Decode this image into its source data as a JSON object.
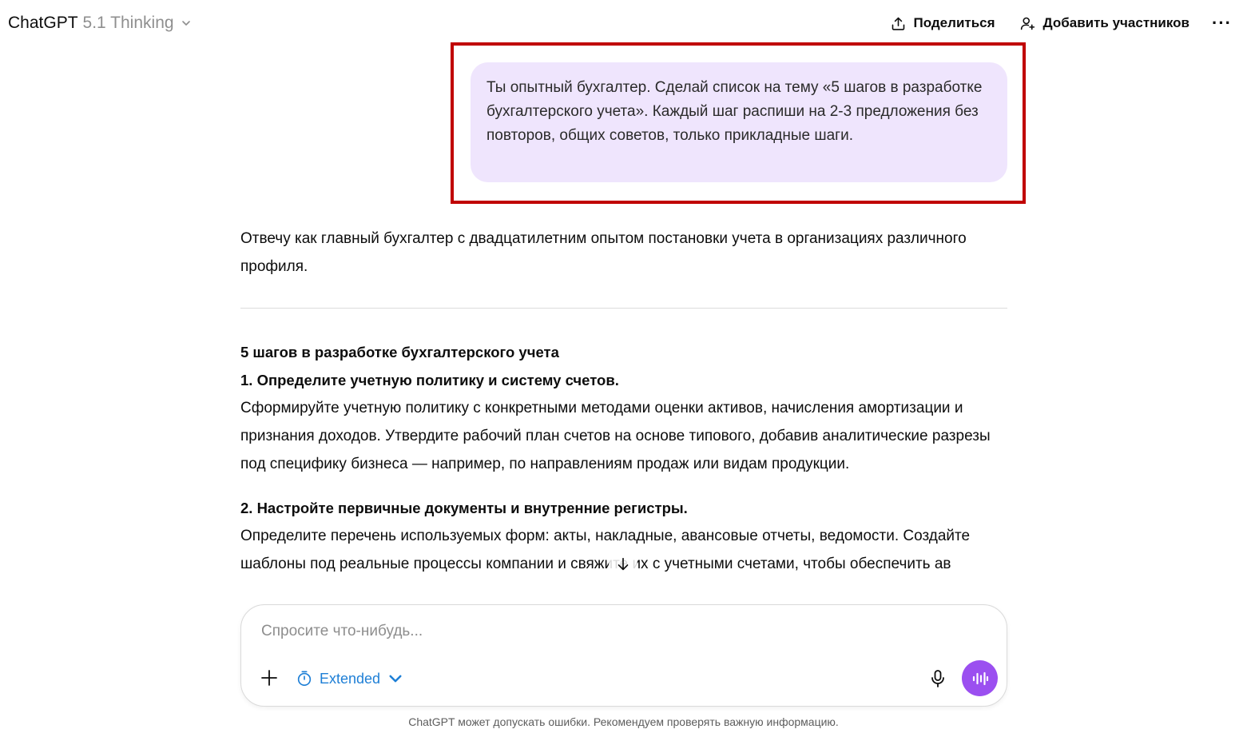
{
  "header": {
    "model_name": "ChatGPT",
    "model_version": "5.1 Thinking",
    "share_label": "Поделиться",
    "add_participants_label": "Добавить участников",
    "more_label": "···"
  },
  "user_message": {
    "text": "Ты опытный бухгалтер. Сделай список на тему «5 шагов в разработке бухгалтерского учета». Каждый шаг распиши на 2-3 предложения без повторов, общих советов, только прикладные шаги."
  },
  "assistant": {
    "intro": "Отвечу как главный бухгалтер с двадцатилетним опытом постановки учета в организациях различного профиля.",
    "heading": "5 шагов в разработке бухгалтерского учета",
    "steps": [
      {
        "title": "1. Определите учетную политику и систему счетов.",
        "body": "Сформируйте учетную политику с конкретными методами оценки активов, начисления амортизации и признания доходов. Утвердите рабочий план счетов на основе типового, добавив аналитические разрезы под специфику бизнеса — например, по направлениям продаж или видам продукции."
      },
      {
        "title": "2. Настройте первичные документы и внутренние регистры.",
        "body": "Определите перечень используемых форм: акты, накладные, авансовые отчеты, ведомости. Создайте шаблоны под реальные процессы компании и свяжите их с учетными счетами, чтобы обеспечить ав"
      }
    ]
  },
  "composer": {
    "placeholder": "Спросите что-нибудь...",
    "mode_label": "Extended"
  },
  "footer": {
    "disclaimer": "ChatGPT может допускать ошибки. Рекомендуем проверять важную информацию."
  },
  "colors": {
    "highlight": "#c00000",
    "user_bubble": "#efe5fd",
    "voice_button": "#9b4ff0",
    "extended_accent": "#1e7fd6"
  },
  "icons": [
    "chevron-down-icon",
    "share-icon",
    "add-person-icon",
    "more-icon",
    "arrow-down-icon",
    "plus-icon",
    "timer-icon",
    "microphone-icon",
    "voice-wave-icon"
  ]
}
